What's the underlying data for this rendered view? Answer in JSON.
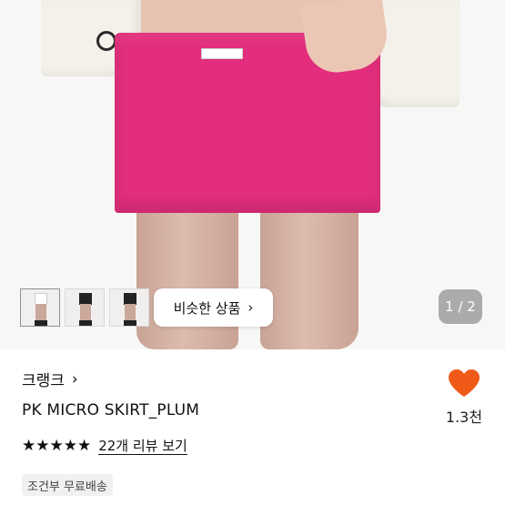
{
  "gallery": {
    "similar_label": "비슷한 상품",
    "similar_chevron": "›",
    "pager": "1 / 2",
    "thumbnails": [
      {
        "name": "white-jacket-look"
      },
      {
        "name": "black-top-look"
      },
      {
        "name": "black-outfit-look"
      }
    ],
    "skirt_color": "#e22e7c"
  },
  "product": {
    "brand": "크랭크",
    "brand_chevron": "›",
    "name": "PK MICRO SKIRT_PLUM",
    "rating_stars": 5,
    "stars": "★★★★★",
    "review_link": "22개 리뷰 보기",
    "shipping_tag": "조건부 무료배송"
  },
  "like": {
    "icon": "heart-icon",
    "color": "#ef5a18",
    "count": "1.3천"
  }
}
